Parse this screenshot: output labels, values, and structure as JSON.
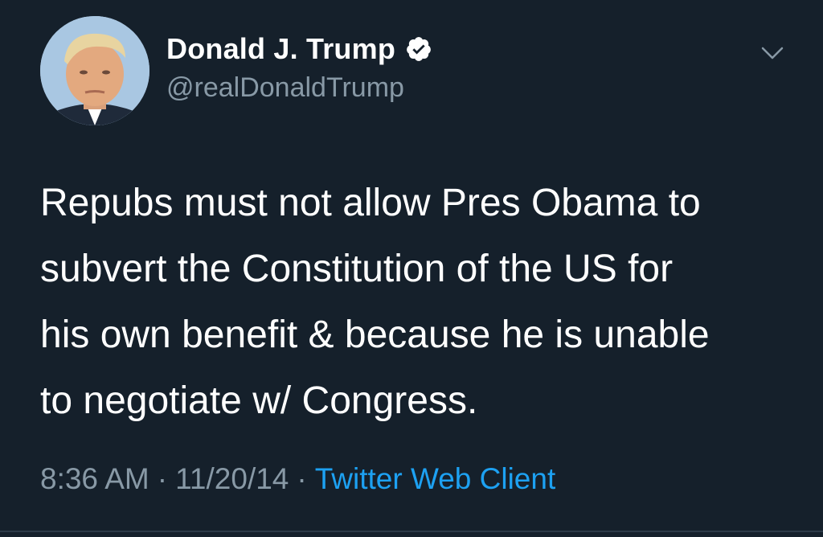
{
  "user": {
    "display_name": "Donald J. Trump",
    "handle": "@realDonaldTrump",
    "verified_icon": "verified-badge-icon",
    "avatar_icon": "profile-avatar"
  },
  "menu": {
    "icon": "chevron-down-icon"
  },
  "tweet": {
    "lines": [
      "Repubs must not allow Pres Obama to",
      "subvert the Constitution of the US for",
      "his own benefit & because he is unable",
      "to negotiate w/ Congress."
    ]
  },
  "meta": {
    "time": "8:36 AM",
    "separator": "·",
    "date": "11/20/14",
    "client": "Twitter Web Client"
  },
  "colors": {
    "background": "#15202b",
    "text": "#ffffff",
    "secondary_text": "#8899a6",
    "link": "#1da1f2"
  }
}
